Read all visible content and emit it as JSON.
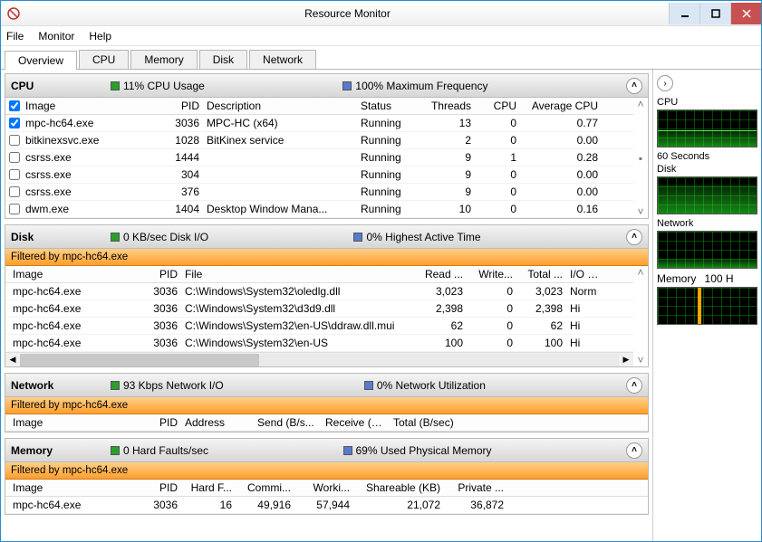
{
  "window": {
    "title": "Resource Monitor"
  },
  "menu": {
    "file": "File",
    "monitor": "Monitor",
    "help": "Help"
  },
  "tabs": {
    "overview": "Overview",
    "cpu": "CPU",
    "memory": "Memory",
    "disk": "Disk",
    "network": "Network"
  },
  "cpu": {
    "title": "CPU",
    "stat1": "11% CPU Usage",
    "stat2": "100% Maximum Frequency",
    "cols": {
      "image": "Image",
      "pid": "PID",
      "desc": "Description",
      "status": "Status",
      "threads": "Threads",
      "cpu": "CPU",
      "avg": "Average CPU"
    },
    "rows": [
      {
        "checked": true,
        "image": "mpc-hc64.exe",
        "pid": "3036",
        "desc": "MPC-HC (x64)",
        "status": "Running",
        "threads": "13",
        "cpu": "0",
        "avg": "0.77"
      },
      {
        "checked": false,
        "image": "bitkinexsvc.exe",
        "pid": "1028",
        "desc": "BitKinex service",
        "status": "Running",
        "threads": "2",
        "cpu": "0",
        "avg": "0.00"
      },
      {
        "checked": false,
        "image": "csrss.exe",
        "pid": "1444",
        "desc": "",
        "status": "Running",
        "threads": "9",
        "cpu": "1",
        "avg": "0.28"
      },
      {
        "checked": false,
        "image": "csrss.exe",
        "pid": "304",
        "desc": "",
        "status": "Running",
        "threads": "9",
        "cpu": "0",
        "avg": "0.00"
      },
      {
        "checked": false,
        "image": "csrss.exe",
        "pid": "376",
        "desc": "",
        "status": "Running",
        "threads": "9",
        "cpu": "0",
        "avg": "0.00"
      },
      {
        "checked": false,
        "image": "dwm.exe",
        "pid": "1404",
        "desc": "Desktop Window Mana...",
        "status": "Running",
        "threads": "10",
        "cpu": "0",
        "avg": "0.16"
      }
    ]
  },
  "disk": {
    "title": "Disk",
    "stat1": "0 KB/sec Disk I/O",
    "stat2": "0% Highest Active Time",
    "filter": "Filtered by mpc-hc64.exe",
    "cols": {
      "image": "Image",
      "pid": "PID",
      "file": "File",
      "read": "Read ...",
      "write": "Write...",
      "total": "Total ...",
      "io": "I/O P..."
    },
    "rows": [
      {
        "image": "mpc-hc64.exe",
        "pid": "3036",
        "file": "C:\\Windows\\System32\\oledlg.dll",
        "read": "3,023",
        "write": "0",
        "total": "3,023",
        "io": "Norm"
      },
      {
        "image": "mpc-hc64.exe",
        "pid": "3036",
        "file": "C:\\Windows\\System32\\d3d9.dll",
        "read": "2,398",
        "write": "0",
        "total": "2,398",
        "io": "Hi"
      },
      {
        "image": "mpc-hc64.exe",
        "pid": "3036",
        "file": "C:\\Windows\\System32\\en-US\\ddraw.dll.mui",
        "read": "62",
        "write": "0",
        "total": "62",
        "io": "Hi"
      },
      {
        "image": "mpc-hc64.exe",
        "pid": "3036",
        "file": "C:\\Windows\\System32\\en-US",
        "read": "100",
        "write": "0",
        "total": "100",
        "io": "Hi"
      }
    ]
  },
  "network": {
    "title": "Network",
    "stat1": "93 Kbps Network I/O",
    "stat2": "0% Network Utilization",
    "filter": "Filtered by mpc-hc64.exe",
    "cols": {
      "image": "Image",
      "pid": "PID",
      "address": "Address",
      "send": "Send (B/s...",
      "recv": "Receive (B...",
      "total": "Total (B/sec)"
    }
  },
  "memory": {
    "title": "Memory",
    "stat1": "0 Hard Faults/sec",
    "stat2": "69% Used Physical Memory",
    "filter": "Filtered by mpc-hc64.exe",
    "cols": {
      "image": "Image",
      "pid": "PID",
      "hf": "Hard F...",
      "commit": "Commi...",
      "work": "Worki...",
      "share": "Shareable (KB)",
      "priv": "Private ..."
    },
    "rows": [
      {
        "image": "mpc-hc64.exe",
        "pid": "3036",
        "hf": "16",
        "commit": "49,916",
        "work": "57,944",
        "share": "21,072",
        "priv": "36,872"
      }
    ]
  },
  "side": {
    "cpu": "CPU",
    "seconds": "60 Seconds",
    "disk": "Disk",
    "network": "Network",
    "memory": "Memory",
    "memval": "100 H"
  }
}
